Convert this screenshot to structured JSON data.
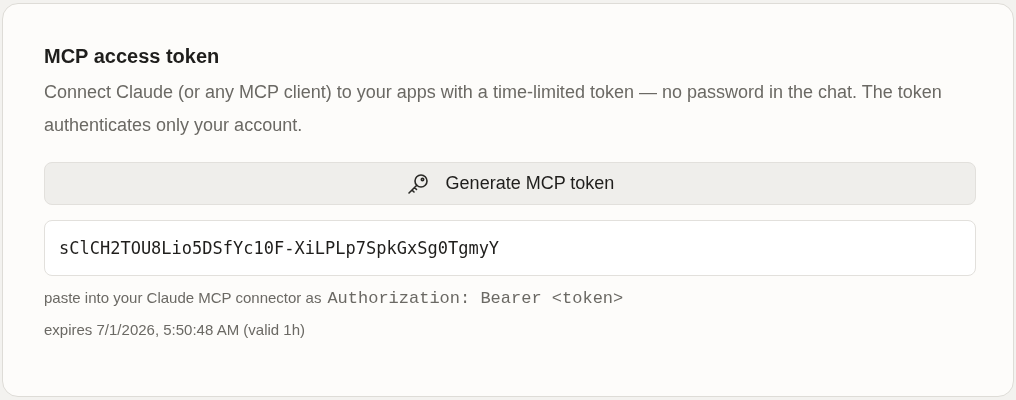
{
  "card": {
    "title": "MCP access token",
    "description": "Connect Claude (or any MCP client) to your apps with a time-limited token — no password in the chat. The token authenticates only your account.",
    "generate_button": {
      "label": "Generate MCP token"
    },
    "token_field": {
      "value": "sClCH2TOU8Lio5DSfYc10F-XiLPLp7SpkGxSg0TgmyY"
    },
    "hint": {
      "text": "paste into your Claude MCP connector as",
      "code": "Authorization: Bearer <token>"
    },
    "expiry": "expires 7/1/2026, 5:50:48 AM (valid 1h)"
  }
}
